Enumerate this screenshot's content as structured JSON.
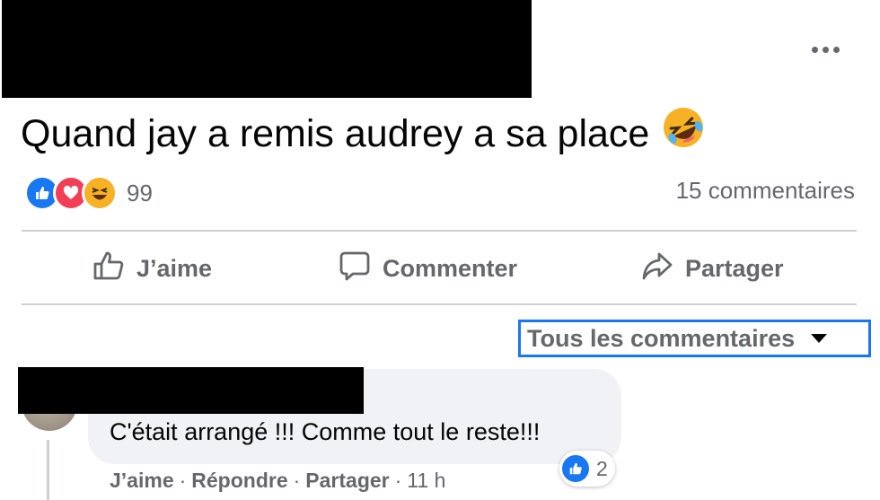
{
  "post": {
    "text": "Quand jay a remis audrey a sa place",
    "emoji_icon": "rolling-on-floor-laughing-emoji"
  },
  "reactions": {
    "icons": [
      "like-icon",
      "love-icon",
      "haha-icon"
    ],
    "count": "99",
    "comments_count": "15 commentaires"
  },
  "actions": {
    "like": "J’aime",
    "comment": "Commenter",
    "share": "Partager"
  },
  "sort": {
    "label": "Tous les commentaires"
  },
  "comment": {
    "text": "C'était arrangé !!! Comme tout le reste!!!",
    "like_count": "2",
    "like": "J’aime",
    "reply": "Répondre",
    "share": "Partager",
    "separator": "·",
    "time": "11 h"
  },
  "colors": {
    "accent": "#1877f2",
    "love": "#f33e58",
    "haha": "#f7b125",
    "secondary_text": "#65676b"
  }
}
